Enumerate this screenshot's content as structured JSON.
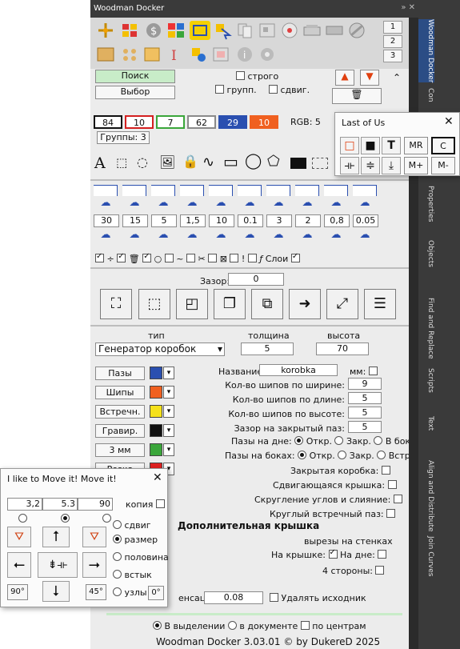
{
  "docker": {
    "title": "Woodman Docker",
    "controls": "» ✕",
    "tabs": [
      "1",
      "2",
      "3"
    ],
    "search_button": "Поиск",
    "select_button": "Выбор",
    "strict_label": "строго",
    "group_label": "групп.",
    "shift_label": "сдвиг.",
    "counters": [
      {
        "value": "84",
        "border": "#111111",
        "bg": "#ffffff"
      },
      {
        "value": "10",
        "border": "#d42020",
        "bg": "#ffffff"
      },
      {
        "value": "7",
        "border": "#3aa63a",
        "bg": "#ffffff"
      },
      {
        "value": "62",
        "border": "#8a8a8a",
        "bg": "#ffffff"
      },
      {
        "value": "29",
        "border": "#2a4fb0",
        "bg": "#2a4fb0"
      },
      {
        "value": "10",
        "border": "#f06020",
        "bg": "#f06020"
      }
    ],
    "rgb_label": "RGB: 5",
    "groups_label": "Группы: 3",
    "corner_values": [
      "30",
      "15",
      "5",
      "1,5",
      "10",
      "0.1",
      "3",
      "2",
      "0,8",
      "0.05"
    ],
    "layers_label": "Слои",
    "gap_label": "Зазор:",
    "gap_value": "0",
    "type_label": "тип",
    "thickness_label": "толщина",
    "height_label": "высота",
    "type_value": "Генератор коробок",
    "thickness_value": "5",
    "height_value": "70",
    "layer_buttons": [
      {
        "label": "Пазы",
        "color": "#2a4fb0"
      },
      {
        "label": "Шипы",
        "color": "#f06020"
      },
      {
        "label": "Встречн.",
        "color": "#f5e11a"
      },
      {
        "label": "Гравир.",
        "color": "#111111"
      },
      {
        "label": "3 мм",
        "color": "#3aa63a"
      },
      {
        "label": "Резка",
        "color": "#e02020"
      }
    ],
    "name_label": "Название:",
    "name_value": "korobka",
    "mm_label": "мм:",
    "params": [
      {
        "label": "Кол-во шипов по ширине:",
        "value": "9"
      },
      {
        "label": "Кол-во шипов по длине:",
        "value": "5"
      },
      {
        "label": "Кол-во шипов по высоте:",
        "value": "5"
      },
      {
        "label": "Зазор на закрытый паз:",
        "value": "5"
      }
    ],
    "bottom_slots_label": "Пазы на дне:",
    "sides_slots_label": "Пазы на боках:",
    "opt_open": "Откр.",
    "opt_closed": "Закр.",
    "opt_bottom_side": "В бок",
    "opt_inline": "Встр.",
    "closed_box_label": "Закрытая коробка:",
    "sliding_lid_label": "Сдвигающаяся крышка:",
    "rounding_label": "Скругление углов и слияние:",
    "round_slot_label": "Круглый встречный паз:",
    "extra_lid_label": "Дополнительная крышка",
    "cutouts_label": "вырезы на стенках",
    "on_lid_label": "На крышке:",
    "on_bottom_label": "На дне:",
    "four_sides_label": "4 стороны:",
    "compensation_label": "енсация",
    "compensation_value": "0.08",
    "delete_source_label": "Удалять исходник",
    "in_selection_label": "В выделении",
    "in_document_label": "в документе",
    "by_centers_label": "по центрам",
    "footer": "Woodman Docker 3.03.01 © by DukereD 2025"
  },
  "side_tabs": [
    "Woodman Docker",
    "Con",
    "Properties",
    "Objects",
    "Find and Replace",
    "Scripts",
    "Text",
    "Align and Distribute",
    "Join Curves"
  ],
  "last_of_us": {
    "title": "Last of Us",
    "row1": [
      "MR",
      "C"
    ],
    "row2": [
      "M+",
      "M-"
    ]
  },
  "move_it": {
    "title": "I like to Move it! Move it!",
    "x_value": "3,2",
    "y_value": "5.3",
    "angle_value": "90",
    "copy_label": "копия",
    "shift_label": "сдвиг",
    "size_label": "размер",
    "half_label": "половина",
    "fit_label": "встык",
    "nodes_label": "узлы",
    "rot90_label": "90°",
    "rot45_label": "45°",
    "rot0_label": "0°"
  }
}
